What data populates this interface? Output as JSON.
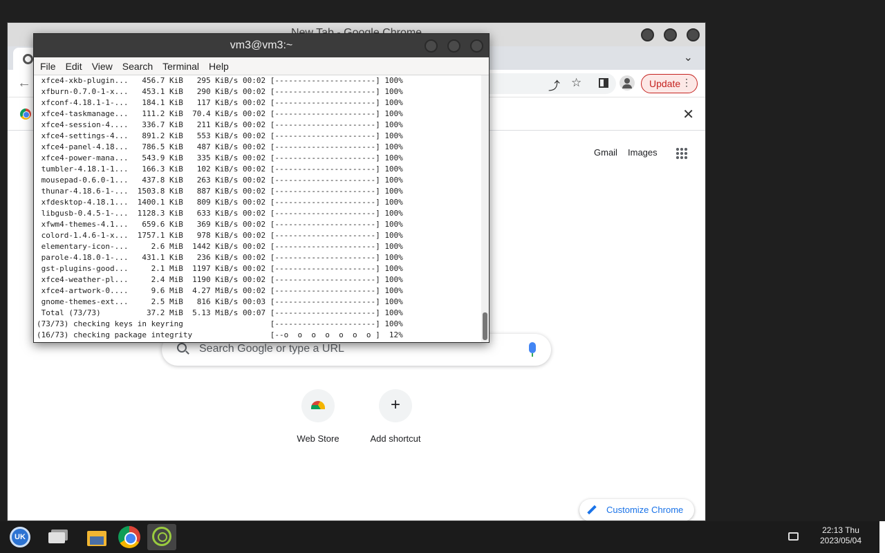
{
  "chrome": {
    "window_title": "New Tab - Google Chrome",
    "update_label": "Update",
    "ntp": {
      "gmail": "Gmail",
      "images": "Images",
      "search_placeholder": "Search Google or type a URL",
      "shortcuts": [
        {
          "label": "Web Store",
          "icon": "web-store-icon"
        },
        {
          "label": "Add shortcut",
          "icon": "plus-icon"
        }
      ],
      "customize_label": "Customize Chrome"
    }
  },
  "terminal": {
    "title": "vm3@vm3:~",
    "menu": [
      "File",
      "Edit",
      "View",
      "Search",
      "Terminal",
      "Help"
    ],
    "lines": [
      " xfce4-xkb-plugin...   456.7 KiB   295 KiB/s 00:02 [----------------------] 100%",
      " xfburn-0.7.0-1-x...   453.1 KiB   290 KiB/s 00:02 [----------------------] 100%",
      " xfconf-4.18.1-1-...   184.1 KiB   117 KiB/s 00:02 [----------------------] 100%",
      " xfce4-taskmanage...   111.2 KiB  70.4 KiB/s 00:02 [----------------------] 100%",
      " xfce4-session-4....   336.7 KiB   211 KiB/s 00:02 [----------------------] 100%",
      " xfce4-settings-4...   891.2 KiB   553 KiB/s 00:02 [----------------------] 100%",
      " xfce4-panel-4.18...   786.5 KiB   487 KiB/s 00:02 [----------------------] 100%",
      " xfce4-power-mana...   543.9 KiB   335 KiB/s 00:02 [----------------------] 100%",
      " tumbler-4.18.1-1...   166.3 KiB   102 KiB/s 00:02 [----------------------] 100%",
      " mousepad-0.6.0-1...   437.8 KiB   263 KiB/s 00:02 [----------------------] 100%",
      " thunar-4.18.6-1-...  1503.8 KiB   887 KiB/s 00:02 [----------------------] 100%",
      " xfdesktop-4.18.1...  1400.1 KiB   809 KiB/s 00:02 [----------------------] 100%",
      " libgusb-0.4.5-1-...  1128.3 KiB   633 KiB/s 00:02 [----------------------] 100%",
      " xfwm4-themes-4.1...   659.6 KiB   369 KiB/s 00:02 [----------------------] 100%",
      " colord-1.4.6-1-x...  1757.1 KiB   978 KiB/s 00:02 [----------------------] 100%",
      " elementary-icon-...     2.6 MiB  1442 KiB/s 00:02 [----------------------] 100%",
      " parole-4.18.0-1-...   431.1 KiB   236 KiB/s 00:02 [----------------------] 100%",
      " gst-plugins-good...     2.1 MiB  1197 KiB/s 00:02 [----------------------] 100%",
      " xfce4-weather-pl...     2.4 MiB  1190 KiB/s 00:02 [----------------------] 100%",
      " xfce4-artwork-0....     9.6 MiB  4.27 MiB/s 00:02 [----------------------] 100%",
      " gnome-themes-ext...     2.5 MiB   816 KiB/s 00:03 [----------------------] 100%",
      " Total (73/73)          37.2 MiB  5.13 MiB/s 00:07 [----------------------] 100%",
      "(73/73) checking keys in keyring                   [----------------------] 100%",
      "(16/73) checking package integrity                 [--o  o  o  o  o  o  o ]  12%"
    ]
  },
  "taskbar": {
    "apps": [
      {
        "name": "start-menu",
        "icon": "uk-icon",
        "label": "UK"
      },
      {
        "name": "show-windows",
        "icon": "windows-icon"
      },
      {
        "name": "file-manager",
        "icon": "files-icon"
      },
      {
        "name": "chrome",
        "icon": "chrome-icon"
      },
      {
        "name": "terminal",
        "icon": "terminal-icon"
      }
    ],
    "clock_time": "22:13 Thu",
    "clock_date": "2023/05/04"
  }
}
